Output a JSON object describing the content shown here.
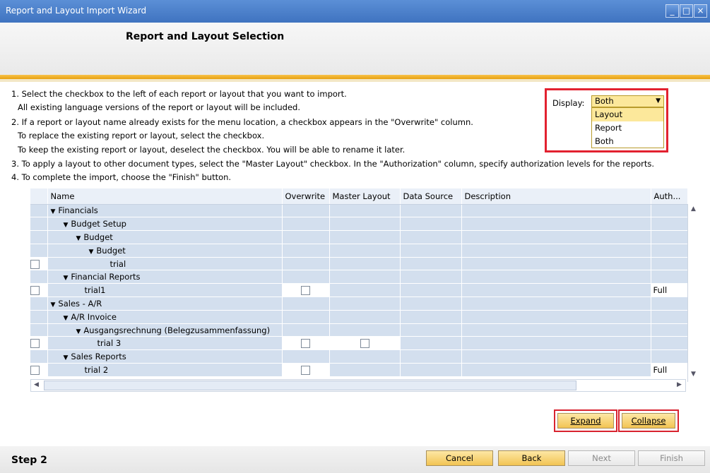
{
  "window": {
    "title": "Report and Layout Import Wizard"
  },
  "header": {
    "heading": "Report and Layout Selection"
  },
  "instructions": [
    "1. Select the checkbox to the left of each report or layout that you want to import.",
    "All existing language versions of the report or layout will be included.",
    "2. If a report or layout name already exists for the menu location, a checkbox appears in the \"Overwrite\" column.",
    "To replace the existing report or layout, select the checkbox.",
    "To keep the existing report or layout, deselect the checkbox. You will be able to rename it later.",
    "3. To apply a layout to other document types, select the \"Master Layout\" checkbox. In the \"Authorization\" column, specify authorization levels for the reports.",
    "4. To complete the import, choose the \"Finish\" button."
  ],
  "display": {
    "label": "Display:",
    "value": "Both",
    "options": [
      "Layout",
      "Report",
      "Both"
    ]
  },
  "columns": [
    "Name",
    "Overwrite",
    "Master Layout",
    "Data Source",
    "Description",
    "Auth..."
  ],
  "rows": [
    {
      "name": "Financials",
      "level": 0,
      "type": "folder"
    },
    {
      "name": "Budget Setup",
      "level": 1,
      "type": "folder"
    },
    {
      "name": "Budget",
      "level": 2,
      "type": "folder"
    },
    {
      "name": "Budget",
      "level": 3,
      "type": "folder"
    },
    {
      "name": "trial",
      "level": 4,
      "type": "item",
      "select": true,
      "overwrite": false,
      "master": false,
      "auth": ""
    },
    {
      "name": "Financial Reports",
      "level": 1,
      "type": "folder"
    },
    {
      "name": "trial1",
      "level": 2,
      "type": "item",
      "select": true,
      "overwrite": true,
      "master": false,
      "auth": "Full"
    },
    {
      "name": "Sales - A/R",
      "level": 0,
      "type": "folder"
    },
    {
      "name": "A/R Invoice",
      "level": 1,
      "type": "folder"
    },
    {
      "name": "Ausgangsrechnung (Belegzusammenfassung)",
      "level": 2,
      "type": "folder"
    },
    {
      "name": "trial 3",
      "level": 3,
      "type": "item",
      "select": true,
      "overwrite": true,
      "master": true,
      "auth": ""
    },
    {
      "name": "Sales Reports",
      "level": 1,
      "type": "folder"
    },
    {
      "name": "trial 2",
      "level": 2,
      "type": "item",
      "select": true,
      "overwrite": true,
      "master": false,
      "auth": "Full"
    }
  ],
  "buttons": {
    "expand": "Expand",
    "collapse": "Collapse",
    "cancel": "Cancel",
    "back": "Back",
    "next": "Next",
    "finish": "Finish"
  },
  "footer": {
    "step": "Step 2"
  },
  "colors": {
    "accent": "#f2c453",
    "highlight": "#e2212f",
    "grid_row": "#d3dfee"
  }
}
